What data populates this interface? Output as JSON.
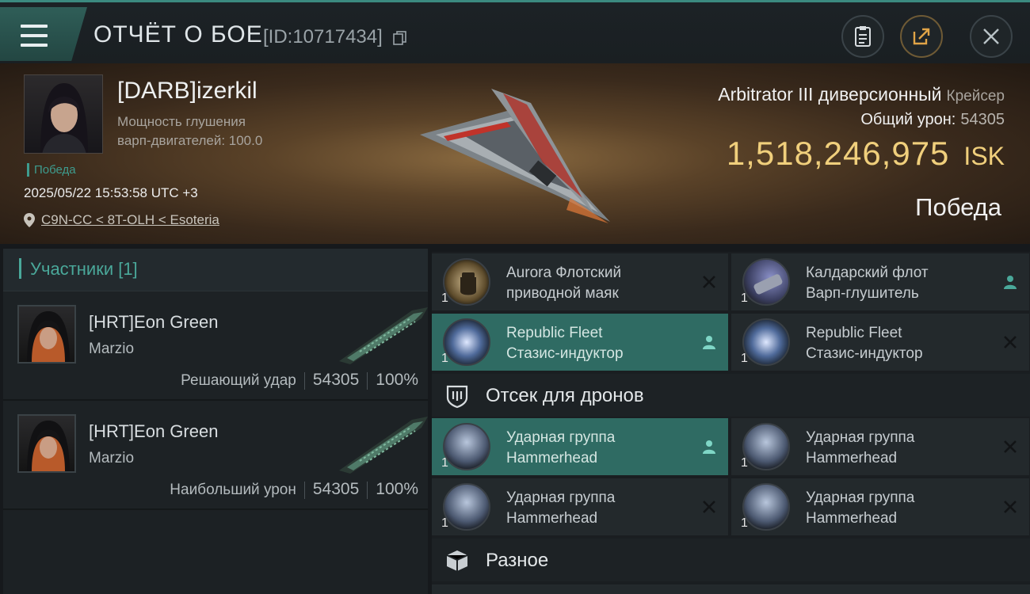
{
  "header": {
    "title": "ОТЧЁТ О БОЕ",
    "report_id": "[ID:10717434]"
  },
  "hero": {
    "pilot_name": "[DARB]izerkil",
    "pilot_stat_line1": "Мощность глушения",
    "pilot_stat_line2": "варп-двигателей: 100.0",
    "status_tag": "Победа",
    "datetime": "2025/05/22 15:53:58 UTC +3",
    "location": "C9N-CC < 8T-OLH < Esoteria",
    "ship_name": "Arbitrator III диверсионный",
    "ship_class": "Крейсер",
    "total_damage_label": "Общий урон:",
    "total_damage_value": "54305",
    "isk_value": "1,518,246,975",
    "isk_unit": "ISK",
    "result": "Победа"
  },
  "participants": {
    "title": "Участники [1]",
    "rows": [
      {
        "name": "[HRT]Eon Green",
        "corp": "Marzio",
        "role": "Решающий удар",
        "damage": "54305",
        "percent": "100%"
      },
      {
        "name": "[HRT]Eon Green",
        "corp": "Marzio",
        "role": "Наибольший урон",
        "damage": "54305",
        "percent": "100%"
      }
    ]
  },
  "modules": {
    "slots": [
      {
        "line1": "Aurora Флотский",
        "line2": "приводной маяк",
        "qty": "1",
        "highlight": false,
        "action": "x",
        "icon": "fist-beacon-icon"
      },
      {
        "line1": "Калдарский флот",
        "line2": "Варп-глушитель",
        "qty": "1",
        "highlight": false,
        "action": "person",
        "icon": "warp-scrambler-icon"
      },
      {
        "line1": "Republic Fleet",
        "line2": "Стазис-индуктор",
        "qty": "1",
        "highlight": true,
        "action": "person",
        "icon": "stasis-web-icon"
      },
      {
        "line1": "Republic Fleet",
        "line2": "Стазис-индуктор",
        "qty": "1",
        "highlight": false,
        "action": "x",
        "icon": "stasis-web-icon"
      }
    ],
    "drone_section_title": "Отсек для дронов",
    "drones": [
      {
        "line1": "Ударная группа",
        "line2": "Hammerhead",
        "qty": "1",
        "highlight": true,
        "action": "person",
        "icon": "drone-icon"
      },
      {
        "line1": "Ударная группа",
        "line2": "Hammerhead",
        "qty": "1",
        "highlight": false,
        "action": "x",
        "icon": "drone-icon"
      },
      {
        "line1": "Ударная группа",
        "line2": "Hammerhead",
        "qty": "1",
        "highlight": false,
        "action": "x",
        "icon": "drone-icon"
      },
      {
        "line1": "Ударная группа",
        "line2": "Hammerhead",
        "qty": "1",
        "highlight": false,
        "action": "x",
        "icon": "drone-icon"
      }
    ],
    "misc_section_title": "Разное"
  },
  "colors": {
    "accent_teal": "#4aa89a",
    "highlight_row": "#2f6b63",
    "isk_gold": "#f0cf7c"
  }
}
